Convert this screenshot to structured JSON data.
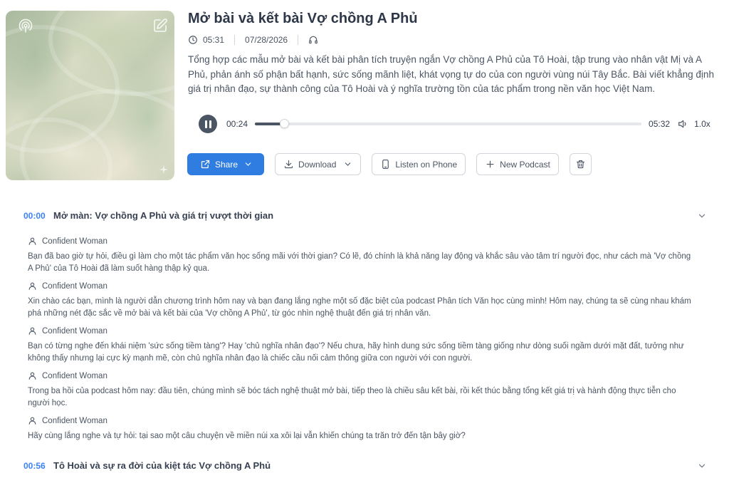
{
  "cover": {
    "icon_left": "podcast-icon",
    "icon_right": "edit-icon",
    "icon_corner": "sparkle-icon"
  },
  "episode": {
    "title": "Mở bài và kết bài Vợ chồng A Phủ",
    "duration": "05:31",
    "date": "07/28/2026",
    "description": "Tổng hợp các mẫu mở bài và kết bài phân tích truyện ngắn Vợ chồng A Phủ của Tô Hoài, tập trung vào nhân vật Mị và A Phủ, phản ánh số phận bất hạnh, sức sống mãnh liệt, khát vọng tự do của con người vùng núi Tây Bắc. Bài viết khẳng định giá trị nhân đạo, sự thành công của Tô Hoài và ý nghĩa trường tồn của tác phẩm trong nền văn học Việt Nam."
  },
  "player": {
    "current": "00:24",
    "total": "05:32",
    "progress": 0.075,
    "speed": "1.0x"
  },
  "actions": {
    "share": "Share",
    "download": "Download",
    "listen": "Listen on Phone",
    "new_podcast": "New Podcast"
  },
  "sections": [
    {
      "time": "00:00",
      "title": "Mở màn: Vợ chồng A Phủ và giá trị vượt thời gian",
      "turns": [
        {
          "speaker": "Confident Woman",
          "text": "Bạn đã bao giờ tự hỏi, điều gì làm cho một tác phẩm văn học sống mãi với thời gian? Có lẽ, đó chính là khả năng lay động và khắc sâu vào tâm trí người đọc, như cách mà 'Vợ chồng A Phủ' của Tô Hoài đã làm suốt hàng thập kỷ qua."
        },
        {
          "speaker": "Confident Woman",
          "text": "Xin chào các bạn, mình là người dẫn chương trình hôm nay và bạn đang lắng nghe một số đặc biệt của podcast Phân tích Văn học cùng mình! Hôm nay, chúng ta sẽ cùng nhau khám phá những nét đặc sắc về mở bài và kết bài của 'Vợ chồng A Phủ', từ góc nhìn nghệ thuật đến giá trị nhân văn."
        },
        {
          "speaker": "Confident Woman",
          "text": "Bạn có từng nghe đến khái niệm 'sức sống tiềm tàng'? Hay 'chủ nghĩa nhân đạo'? Nếu chưa, hãy hình dung sức sống tiềm tàng giống như dòng suối ngầm dưới mặt đất, tưởng như không thấy nhưng lại cực kỳ mạnh mẽ, còn chủ nghĩa nhân đạo là chiếc cầu nối cảm thông giữa con người với con người."
        },
        {
          "speaker": "Confident Woman",
          "text": "Trong ba hồi của podcast hôm nay: đầu tiên, chúng mình sẽ bóc tách nghệ thuật mở bài, tiếp theo là chiều sâu kết bài, rồi kết thúc bằng tổng kết giá trị và hành động thực tiễn cho người học."
        },
        {
          "speaker": "Confident Woman",
          "text": "Hãy cùng lắng nghe và tự hỏi: tại sao một câu chuyện về miền núi xa xôi lại vẫn khiến chúng ta trăn trở đến tận bây giờ?"
        }
      ]
    },
    {
      "time": "00:56",
      "title": "Tô Hoài và sự ra đời của kiệt tác Vợ chồng A Phủ",
      "turns": []
    }
  ]
}
